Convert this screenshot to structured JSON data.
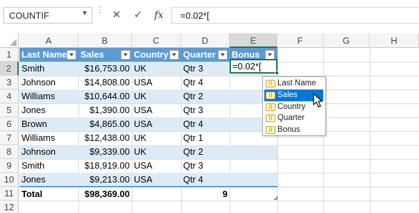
{
  "name_box": {
    "value": "COUNTIF"
  },
  "formula_bar": {
    "cancel_icon": "✕",
    "enter_icon": "✓",
    "fx_label": "fx",
    "value": "=0.02*["
  },
  "columns": [
    "A",
    "B",
    "C",
    "D",
    "E",
    "F",
    "G",
    "H"
  ],
  "selected_column": "E",
  "selected_row": "2",
  "rows": [
    "1",
    "2",
    "3",
    "4",
    "5",
    "6",
    "7",
    "8",
    "9",
    "10",
    "11",
    "12"
  ],
  "table": {
    "headers": [
      "Last Name",
      "Sales",
      "Country",
      "Quarter",
      "Bonus"
    ],
    "data": [
      [
        "Smith",
        "$16,753.00",
        "UK",
        "Qtr 3"
      ],
      [
        "Johnson",
        "$14,808.00",
        "USA",
        "Qtr 4"
      ],
      [
        "Williams",
        "$10,644.00",
        "UK",
        "Qtr 2"
      ],
      [
        "Jones",
        "$1,390.00",
        "USA",
        "Qtr 3"
      ],
      [
        "Brown",
        "$4,865.00",
        "USA",
        "Qtr 4"
      ],
      [
        "Williams",
        "$12,438.00",
        "UK",
        "Qtr 1"
      ],
      [
        "Johnson",
        "$9,339.00",
        "UK",
        "Qtr 2"
      ],
      [
        "Smith",
        "$18,919.00",
        "USA",
        "Qtr 3"
      ],
      [
        "Jones",
        "$9,213.00",
        "USA",
        "Qtr 4"
      ]
    ],
    "total": {
      "label": "Total",
      "sales": "$98,369.00",
      "count": "9"
    }
  },
  "active_cell": {
    "ref": "E2",
    "value": "=0.02*["
  },
  "autocomplete": {
    "items": [
      "Last Name",
      "Sales",
      "Country",
      "Quarter",
      "Bonus"
    ],
    "selected": "Sales"
  },
  "colors": {
    "header_fill": "#5b9bd5",
    "band_fill": "#ddebf7",
    "selection": "#217346",
    "dropdown_highlight": "#0078d7"
  },
  "icons": {
    "cancel": "cancel-icon",
    "enter": "enter-icon",
    "field": "table-field-icon",
    "cursor": "mouse-pointer-icon"
  }
}
